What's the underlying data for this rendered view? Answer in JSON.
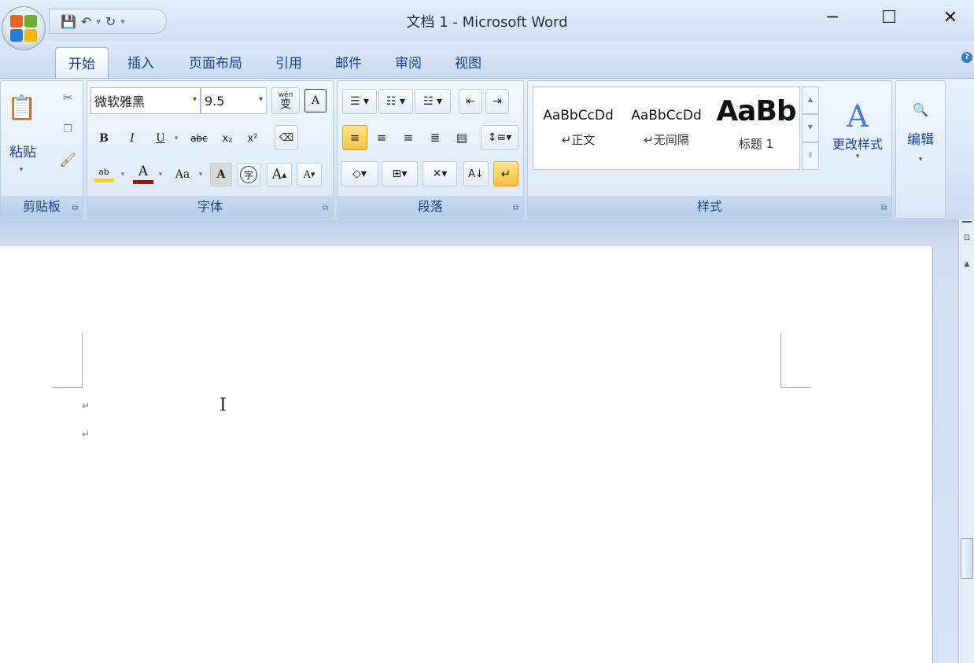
{
  "window": {
    "title": "文档 1 - Microsoft Word",
    "minimize": "─",
    "maximize": "☐",
    "close": "✕"
  },
  "qat": {
    "save_icon": "save-icon",
    "undo_icon": "undo-icon",
    "redo_icon": "redo-icon"
  },
  "tabs": [
    {
      "label": "开始",
      "active": true
    },
    {
      "label": "插入"
    },
    {
      "label": "页面布局"
    },
    {
      "label": "引用"
    },
    {
      "label": "邮件"
    },
    {
      "label": "审阅"
    },
    {
      "label": "视图"
    }
  ],
  "clipboard": {
    "label": "剪贴板",
    "paste": "粘贴"
  },
  "font": {
    "label": "字体",
    "name": "微软雅黑",
    "size": "9.5",
    "phonetic": "wén",
    "phonetic_char": "变",
    "bold": "B",
    "italic": "I",
    "underline": "U",
    "strike": "abc",
    "sub": "x₂",
    "sup": "x²",
    "grow": "A",
    "shrink": "A",
    "case": "Aa",
    "char_shade": "A",
    "enclose": "字",
    "border_char": "A"
  },
  "paragraph": {
    "label": "段落"
  },
  "styles": {
    "label": "样式",
    "items": [
      {
        "preview": "AaBbCcDd",
        "name": "↵正文"
      },
      {
        "preview": "AaBbCcDd",
        "name": "↵无间隔"
      },
      {
        "preview": "AaBb",
        "name": "标题 1"
      }
    ],
    "change": "更改样式"
  },
  "editing": {
    "label": "编辑"
  },
  "colors": {
    "highlight": "#ffd600",
    "font_color": "#c00000",
    "accent": "#15428b"
  },
  "document": {
    "para_marks": [
      "↵",
      "↵"
    ]
  }
}
